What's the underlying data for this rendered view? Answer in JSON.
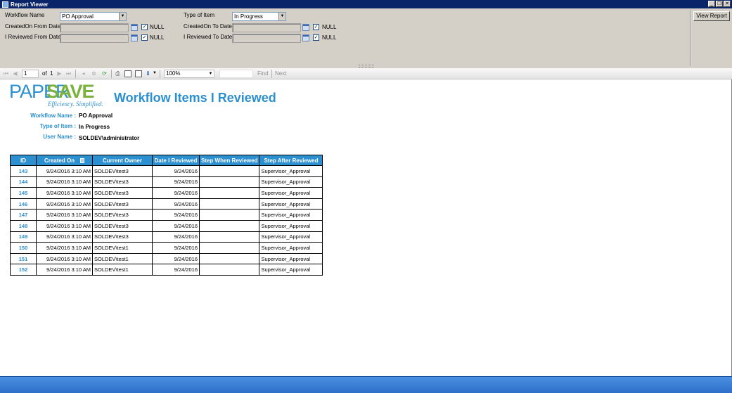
{
  "window": {
    "title": "Report Viewer"
  },
  "params": {
    "workflow_name_label": "Workflow Name",
    "workflow_name_value": "PO Approval",
    "type_of_item_label": "Type of Item",
    "type_of_item_value": "In Progress",
    "created_from_label": "CreatedOn From Date",
    "created_to_label": "CreatedOn To Date",
    "reviewed_from_label": "I Reviewed From Date",
    "reviewed_to_label": "I Reviewed To Date",
    "null_label": "NULL",
    "checkmark": "✓",
    "view_report_label": "View Report"
  },
  "toolbar": {
    "page_current": "1",
    "page_of": "of",
    "page_total": "1",
    "zoom": "100%",
    "find_label": "Find",
    "next_label": "Next"
  },
  "report": {
    "logo_paper": "PAPER",
    "logo_save": "SAVE",
    "logo_tagline": "Efficiency. Simplified.",
    "title": "Workflow Items I Reviewed",
    "info": [
      {
        "label": "Workflow Name :",
        "value": "PO Approval"
      },
      {
        "label": "Type of Item :",
        "value": "In Progress"
      },
      {
        "label": "User Name :",
        "value": "SOLDEV\\administrator"
      }
    ],
    "columns": [
      "ID",
      "Created On",
      "Current Owner",
      "Date I Reviewed",
      "Step When Reviewed",
      "Step After Reviewed"
    ],
    "rows": [
      {
        "id": "143",
        "created": "9/24/2016 3:10 AM",
        "owner": "SOLDEV\\test3",
        "reviewed": "9/24/2016",
        "step_when": "",
        "step_after": "Supervisor_Approval"
      },
      {
        "id": "144",
        "created": "9/24/2016 3:10 AM",
        "owner": "SOLDEV\\test3",
        "reviewed": "9/24/2016",
        "step_when": "",
        "step_after": "Supervisor_Approval"
      },
      {
        "id": "145",
        "created": "9/24/2016 3:10 AM",
        "owner": "SOLDEV\\test3",
        "reviewed": "9/24/2016",
        "step_when": "",
        "step_after": "Supervisor_Approval"
      },
      {
        "id": "146",
        "created": "9/24/2016 3:10 AM",
        "owner": "SOLDEV\\test3",
        "reviewed": "9/24/2016",
        "step_when": "",
        "step_after": "Supervisor_Approval"
      },
      {
        "id": "147",
        "created": "9/24/2016 3:10 AM",
        "owner": "SOLDEV\\test3",
        "reviewed": "9/24/2016",
        "step_when": "",
        "step_after": "Supervisor_Approval"
      },
      {
        "id": "148",
        "created": "9/24/2016 3:10 AM",
        "owner": "SOLDEV\\test3",
        "reviewed": "9/24/2016",
        "step_when": "",
        "step_after": "Supervisor_Approval"
      },
      {
        "id": "149",
        "created": "9/24/2016 3:10 AM",
        "owner": "SOLDEV\\test3",
        "reviewed": "9/24/2016",
        "step_when": "",
        "step_after": "Supervisor_Approval"
      },
      {
        "id": "150",
        "created": "9/24/2016 3:10 AM",
        "owner": "SOLDEV\\test1",
        "reviewed": "9/24/2016",
        "step_when": "",
        "step_after": "Supervisor_Approval"
      },
      {
        "id": "151",
        "created": "9/24/2016 3:10 AM",
        "owner": "SOLDEV\\test1",
        "reviewed": "9/24/2016",
        "step_when": "",
        "step_after": "Supervisor_Approval"
      },
      {
        "id": "152",
        "created": "9/24/2016 3:10 AM",
        "owner": "SOLDEV\\test1",
        "reviewed": "9/24/2016",
        "step_when": "",
        "step_after": "Supervisor_Approval"
      }
    ]
  },
  "colors": {
    "accent": "#2b8fd0",
    "logo_green": "#7ab23c",
    "titlebar": "#0a246a"
  }
}
